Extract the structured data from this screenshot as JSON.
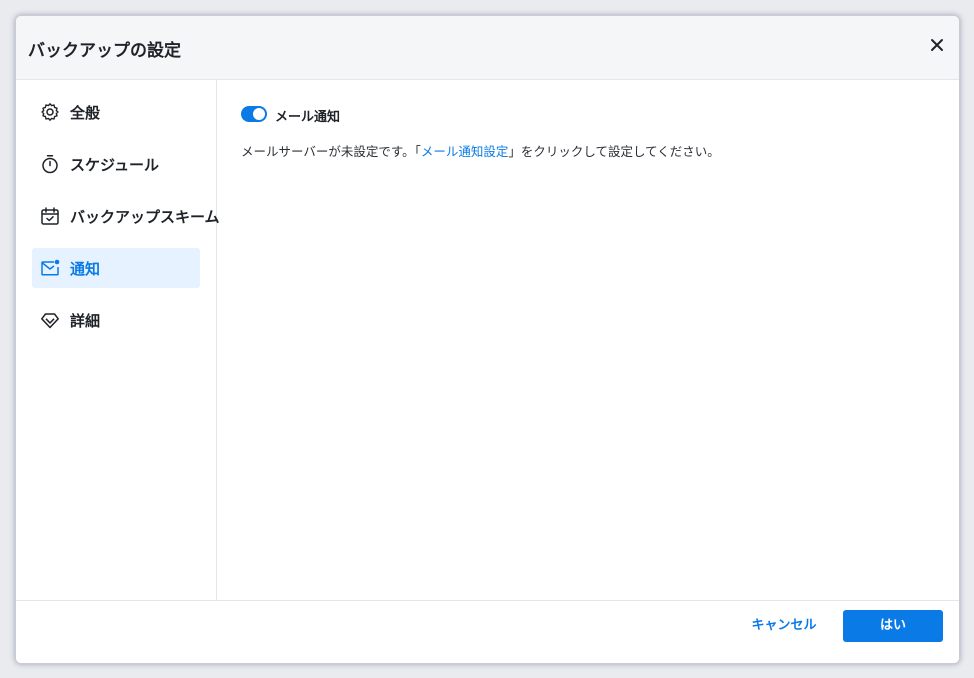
{
  "dialog": {
    "title": "バックアップの設定",
    "close_icon": "close-icon"
  },
  "sidebar": {
    "items": [
      {
        "label": "全般",
        "icon": "gear-icon",
        "active": false
      },
      {
        "label": "スケジュール",
        "icon": "timer-icon",
        "active": false
      },
      {
        "label": "バックアップスキーム",
        "icon": "calendar-check-icon",
        "active": false
      },
      {
        "label": "通知",
        "icon": "mail-notification-icon",
        "active": true
      },
      {
        "label": "詳細",
        "icon": "diamond-icon",
        "active": false
      }
    ]
  },
  "content": {
    "toggle": {
      "label": "メール通知",
      "on": true
    },
    "desc_prefix": "メールサーバーが未設定です。「",
    "desc_link": "メール通知設定",
    "desc_suffix": "」をクリックして設定してください。"
  },
  "footer": {
    "cancel_label": "キャンセル",
    "ok_label": "はい"
  },
  "colors": {
    "accent": "#0a7be6",
    "active_bg": "#e6f2ff",
    "title_bar_bg": "#f5f6f8"
  }
}
